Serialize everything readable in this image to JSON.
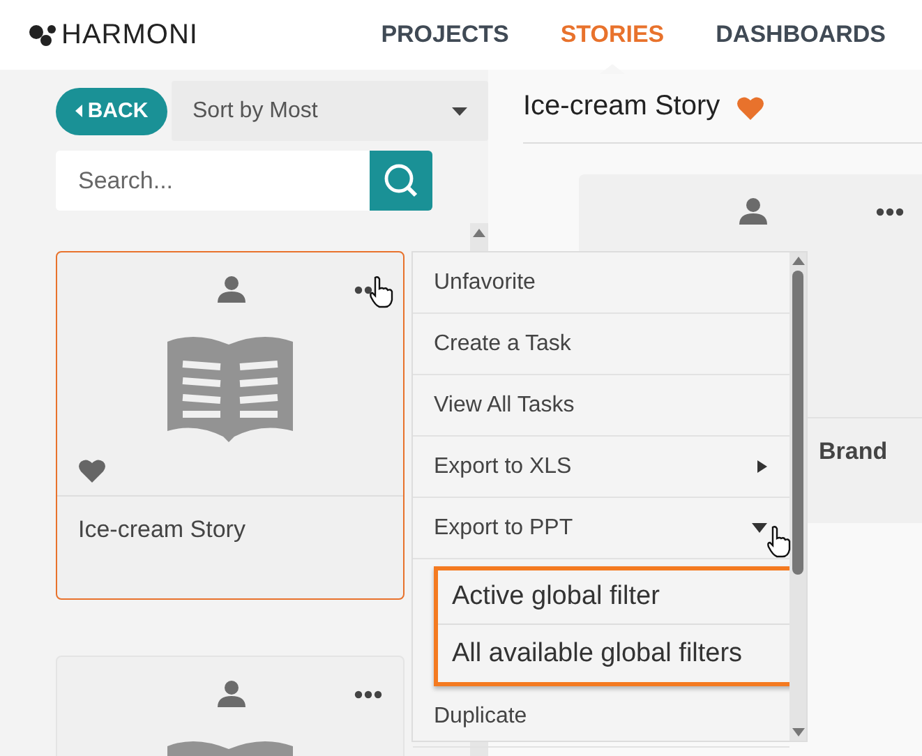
{
  "header": {
    "logo": "HARMONI",
    "nav": [
      {
        "label": "PROJECTS",
        "selected": false
      },
      {
        "label": "STORIES",
        "selected": true
      },
      {
        "label": "DASHBOARDS",
        "selected": false
      }
    ]
  },
  "sidebar": {
    "back_button": "BACK",
    "sort": {
      "value": "Sort by Most"
    },
    "search": {
      "placeholder": "Search..."
    },
    "cards": [
      {
        "title": "Ice-cream Story",
        "favorite": true,
        "selected": true
      },
      {
        "selected": false
      }
    ]
  },
  "story": {
    "title": "Ice-cream Story",
    "favorite": true,
    "card": {
      "title": "Brand"
    }
  },
  "menu": {
    "items": [
      {
        "label": "Unfavorite",
        "kind": "plain"
      },
      {
        "label": "Create a Task",
        "kind": "plain"
      },
      {
        "label": "View All Tasks",
        "kind": "plain"
      },
      {
        "label": "Export to XLS",
        "kind": "submenu",
        "expanded": false
      },
      {
        "label": "Export to PPT",
        "kind": "submenu",
        "expanded": true,
        "children": [
          {
            "label": "Active global filter"
          },
          {
            "label": "All available global filters"
          }
        ]
      },
      {
        "label": "Duplicate",
        "kind": "plain"
      }
    ]
  }
}
